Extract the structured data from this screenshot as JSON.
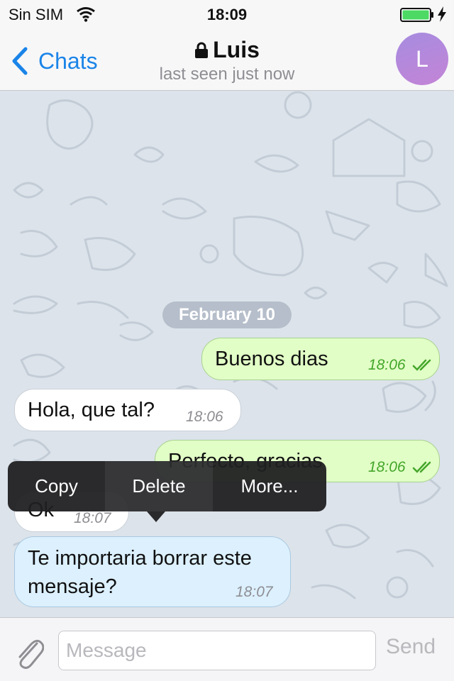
{
  "status_bar": {
    "carrier": "Sin SIM",
    "time": "18:09",
    "battery_color": "#4cd964"
  },
  "nav": {
    "back_label": "Chats",
    "title": "Luis",
    "subtitle": "last seen just now",
    "avatar_letter": "L",
    "accent": "#1a84e8"
  },
  "chat": {
    "date_separator": "February 10",
    "messages": [
      {
        "direction": "out",
        "text": "Buenos dias",
        "time": "18:06",
        "status": "read"
      },
      {
        "direction": "in",
        "text": "Hola, que tal?",
        "time": "18:06"
      },
      {
        "direction": "out",
        "text": "Perfecto, gracias",
        "time": "18:06",
        "status": "read"
      },
      {
        "direction": "in",
        "text": "Ok",
        "time": "18:07"
      },
      {
        "direction": "in",
        "text": "Te importaria borrar este mensaje?",
        "time": "18:07",
        "selected": true
      }
    ]
  },
  "context_menu": {
    "items": [
      "Copy",
      "Delete",
      "More..."
    ]
  },
  "input_bar": {
    "placeholder": "Message",
    "send_label": "Send",
    "attach_icon": "paperclip-icon"
  }
}
